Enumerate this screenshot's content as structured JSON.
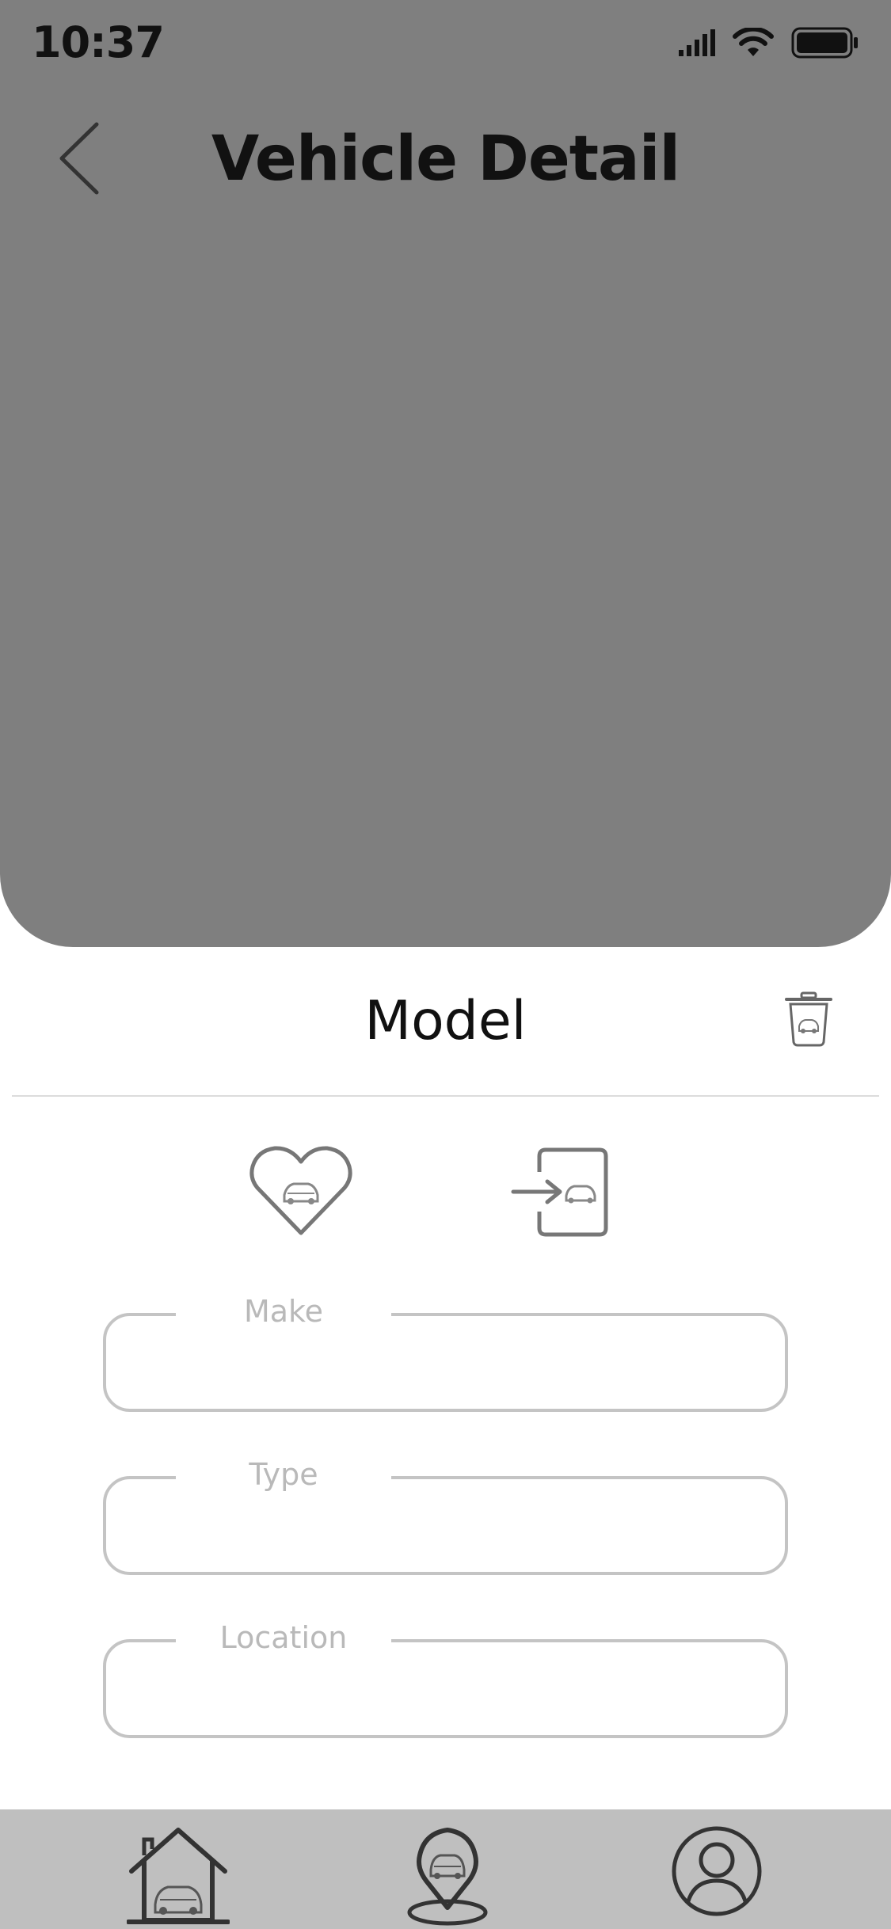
{
  "status_bar": {
    "time": "10:37",
    "icons": [
      "signal-icon",
      "wifi-icon",
      "battery-icon"
    ]
  },
  "header": {
    "title": "Vehicle Detail",
    "back_icon": "chevron-left-icon"
  },
  "vehicle": {
    "model_title": "Model",
    "delete_icon": "trash-car-icon"
  },
  "actions": {
    "favorite_icon": "heart-car-icon",
    "checkin_icon": "enter-car-icon"
  },
  "fields": {
    "make": {
      "label": "Make",
      "value": ""
    },
    "type": {
      "label": "Type",
      "value": ""
    },
    "location": {
      "label": "Location",
      "value": ""
    }
  },
  "tab_bar": {
    "tabs": [
      {
        "icon": "garage-car-icon"
      },
      {
        "icon": "map-pin-car-icon"
      },
      {
        "icon": "profile-icon"
      }
    ]
  },
  "colors": {
    "hero_background": "#7f7f7f",
    "tab_bar_background": "#bfbfbf",
    "field_border": "#c4c4c4",
    "label_text": "#b9b9b9"
  }
}
